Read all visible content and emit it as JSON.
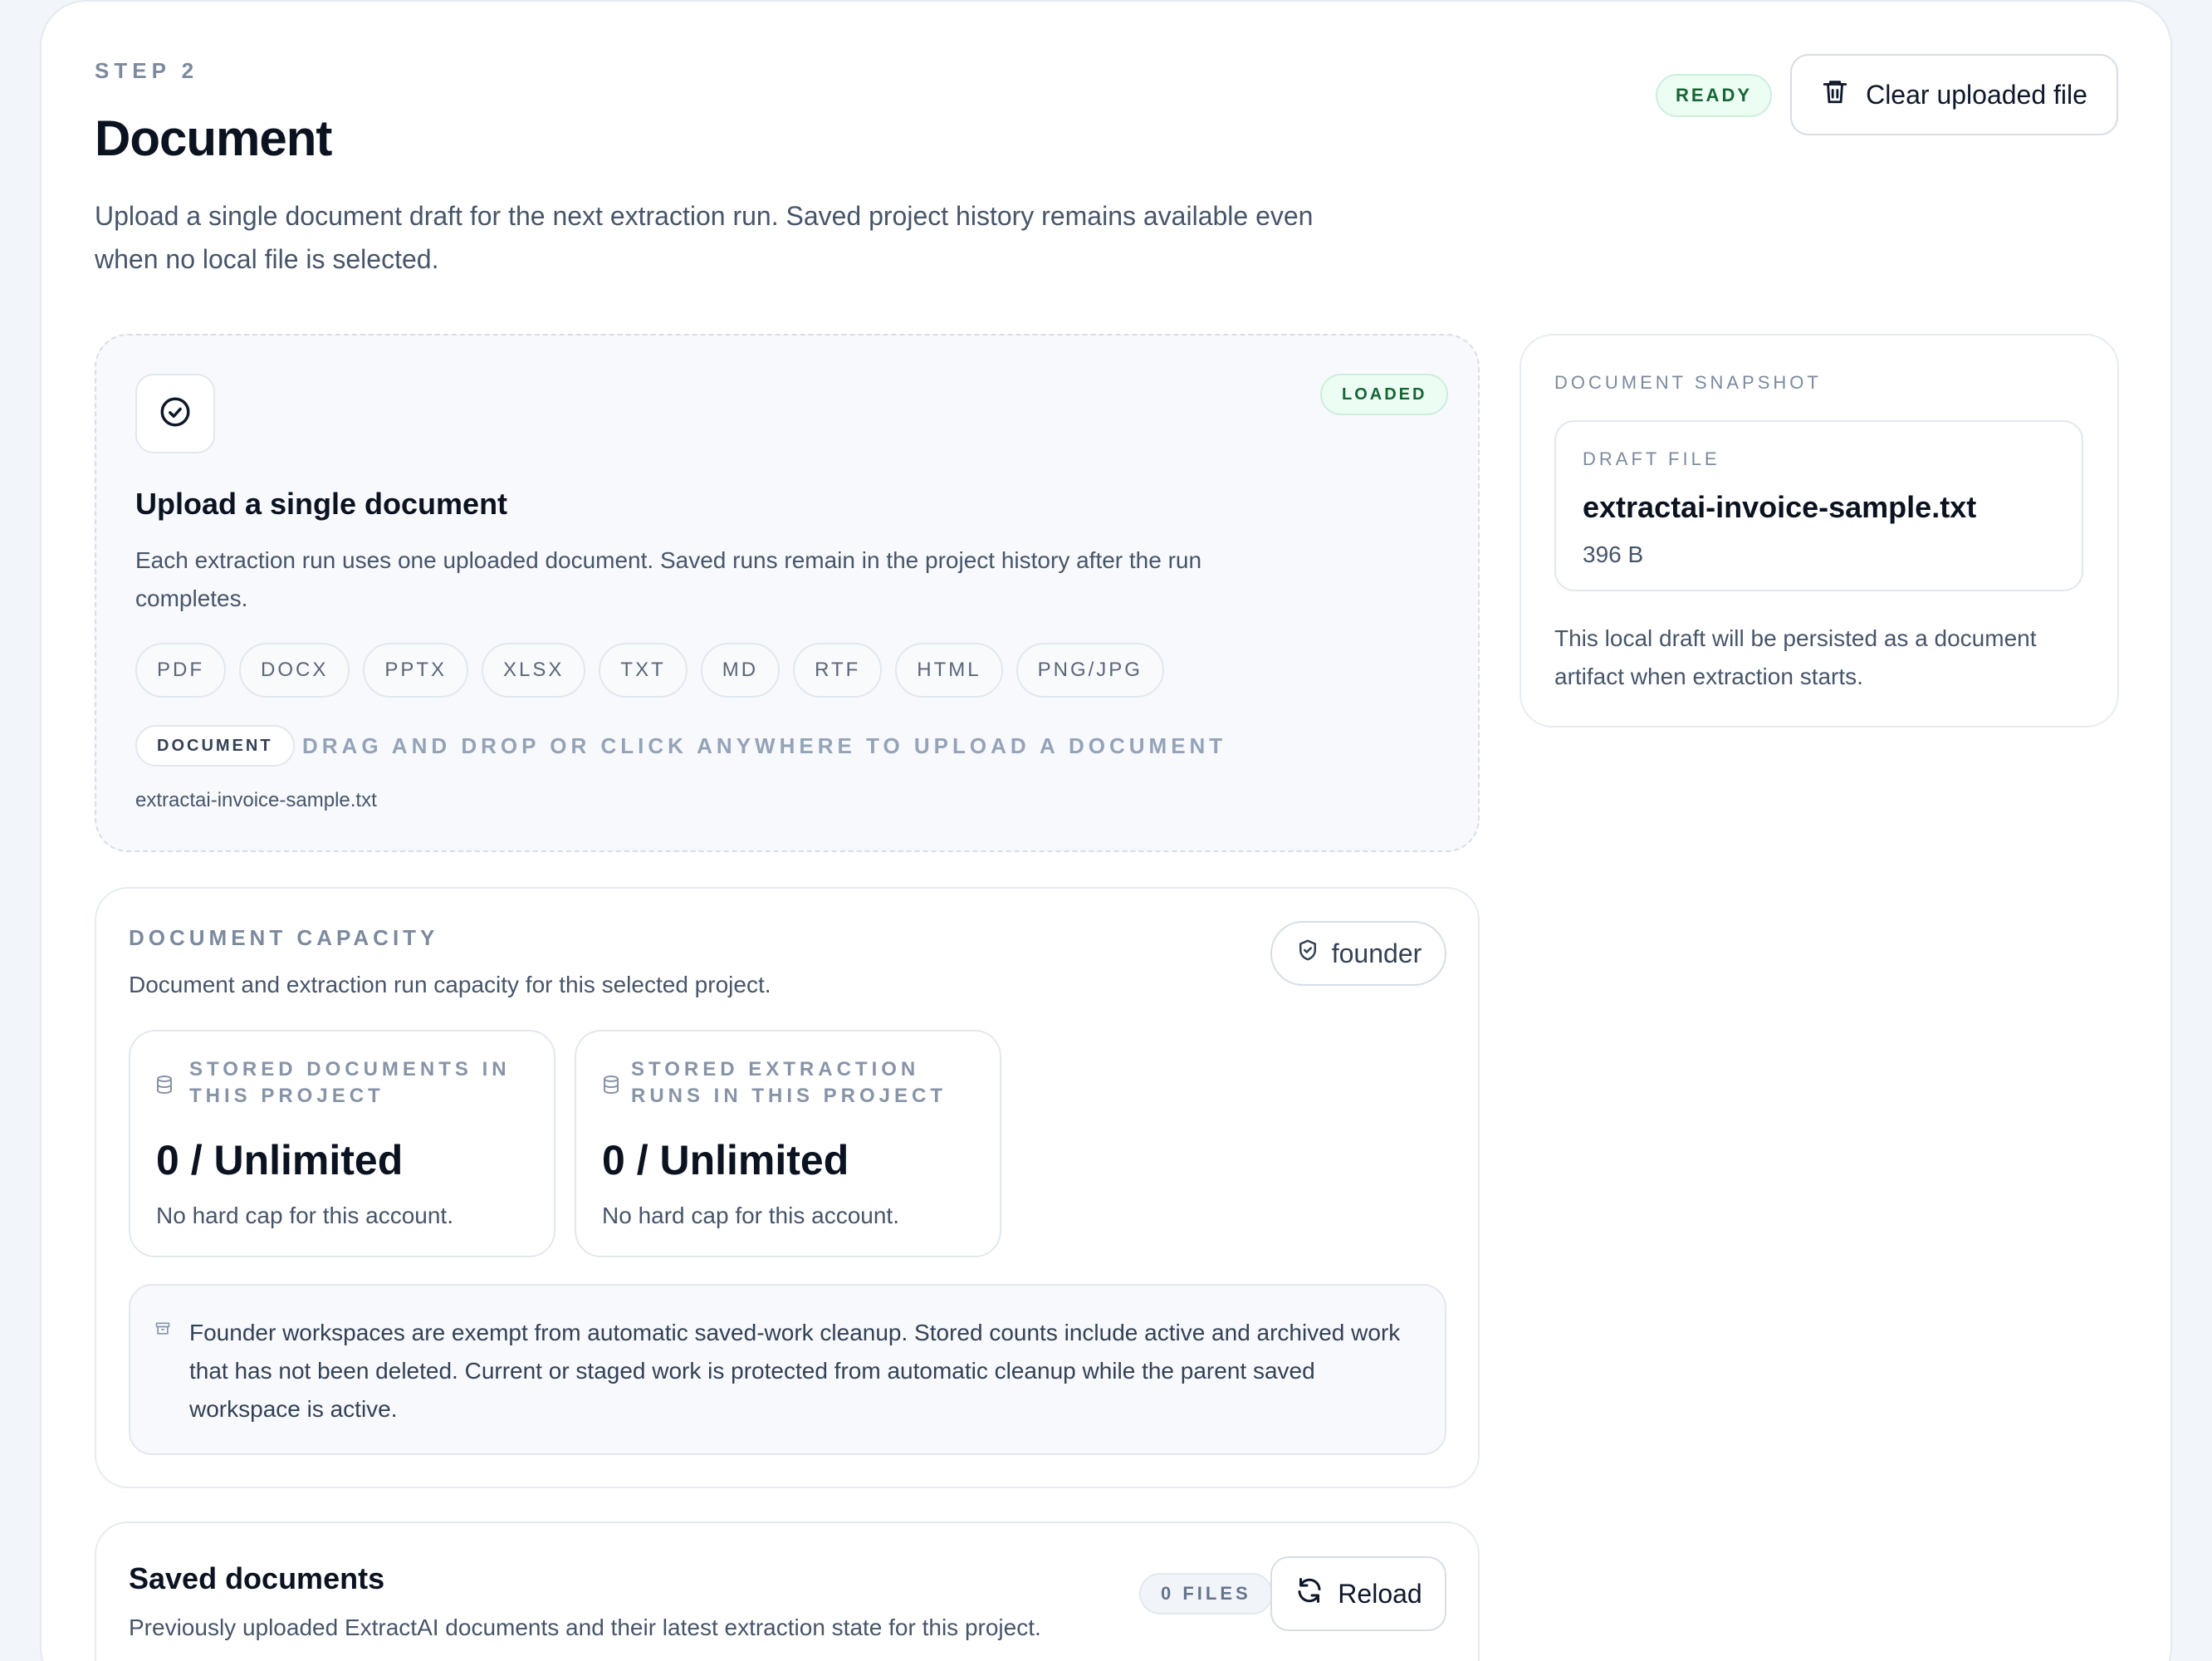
{
  "header": {
    "step_label": "STEP 2",
    "title": "Document",
    "description": "Upload a single document draft for the next extraction run. Saved project history remains available even when no local file is selected.",
    "status_badge": "READY",
    "clear_button_label": "Clear uploaded file"
  },
  "upload": {
    "status_badge": "LOADED",
    "title": "Upload a single document",
    "description": "Each extraction run uses one uploaded document. Saved runs remain in the project history after the run completes.",
    "formats": [
      "PDF",
      "DOCX",
      "PPTX",
      "XLSX",
      "TXT",
      "MD",
      "RTF",
      "HTML",
      "PNG/JPG"
    ],
    "document_chip": "DOCUMENT",
    "drag_text": "DRAG AND DROP OR CLICK ANYWHERE TO UPLOAD A DOCUMENT",
    "file_name": "extractai-invoice-sample.txt"
  },
  "snapshot": {
    "label": "DOCUMENT SNAPSHOT",
    "draft_label": "DRAFT FILE",
    "draft_name": "extractai-invoice-sample.txt",
    "draft_size": "396 B",
    "note": "This local draft will be persisted as a document artifact when extraction starts."
  },
  "capacity": {
    "label": "DOCUMENT CAPACITY",
    "description": "Document and extraction run capacity for this selected project.",
    "role_button": "founder",
    "stats": [
      {
        "label": "STORED DOCUMENTS IN THIS PROJECT",
        "value": "0 / Unlimited",
        "note": "No hard cap for this account."
      },
      {
        "label": "STORED EXTRACTION RUNS IN THIS PROJECT",
        "value": "0 / Unlimited",
        "note": "No hard cap for this account."
      }
    ],
    "notice": "Founder workspaces are exempt from automatic saved-work cleanup. Stored counts include active and archived work that has not been deleted. Current or staged work is protected from automatic cleanup while the parent saved workspace is active."
  },
  "saved_documents": {
    "title": "Saved documents",
    "description": "Previously uploaded ExtractAI documents and their latest extraction state for this project.",
    "count_badge": "0 FILES",
    "reload_label": "Reload"
  },
  "colors": {
    "success_bg": "#ecfdf3",
    "success_text": "#166534",
    "muted_label": "#7c8a9e"
  },
  "icons": [
    "trash-icon",
    "check-circle-icon",
    "shield-check-icon",
    "database-icon",
    "archive-icon",
    "refresh-icon"
  ]
}
